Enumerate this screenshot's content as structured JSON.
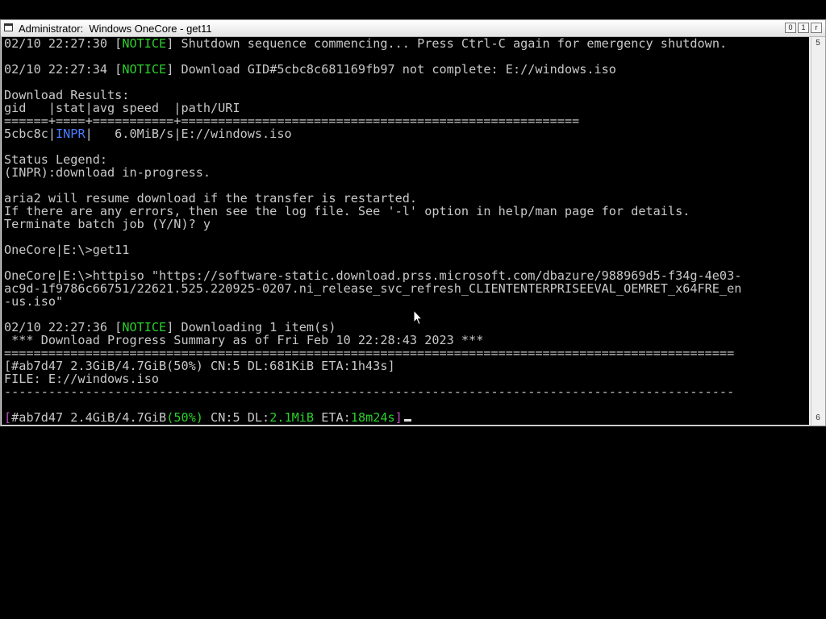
{
  "window": {
    "title": "Administrator:  Windows OneCore - get11",
    "controls": {
      "minimize": "0",
      "maximize": "1",
      "close": "r"
    }
  },
  "scrollbar": {
    "up_glyph": "5",
    "down_glyph": "6"
  },
  "console": {
    "lines": [
      [
        "02/10 22:27:30 [",
        "NOTICE",
        "] Shutdown sequence commencing... Press Ctrl-C again for emergency shutdown."
      ],
      [
        ""
      ],
      [
        "02/10 22:27:34 [",
        "NOTICE",
        "] Download GID#5cbc8c681169fb97 not complete: E://windows.iso"
      ],
      [
        ""
      ],
      [
        "Download Results:"
      ],
      [
        "gid   |stat|avg speed  |path/URI"
      ],
      [
        "======+====+===========+======================================================"
      ],
      [
        "5cbc8c|",
        "INPR",
        "|   6.0MiB/s|E://windows.iso"
      ],
      [
        ""
      ],
      [
        "Status Legend:"
      ],
      [
        "(INPR):download in-progress."
      ],
      [
        ""
      ],
      [
        "aria2 will resume download if the transfer is restarted."
      ],
      [
        "If there are any errors, then see the log file. See '-l' option in help/man page for details."
      ],
      [
        "Terminate batch job (Y/N)? y"
      ],
      [
        ""
      ],
      [
        "OneCore|E:\\>get11"
      ],
      [
        ""
      ],
      [
        "OneCore|E:\\>httpiso \"https://software-static.download.prss.microsoft.com/dbazure/988969d5-f34g-4e03-"
      ],
      [
        "ac9d-1f9786c66751/22621.525.220925-0207.ni_release_svc_refresh_CLIENTENTERPRISEEVAL_OEMRET_x64FRE_en"
      ],
      [
        "-us.iso\""
      ],
      [
        ""
      ],
      [
        "02/10 22:27:36 [",
        "NOTICE",
        "] Downloading 1 item(s)"
      ],
      [
        " *** Download Progress Summary as of Fri Feb 10 22:28:43 2023 ***"
      ],
      [
        "==================================================================================================="
      ],
      [
        "[#ab7d47 2.3GiB/4.7GiB(50%) CN:5 DL:681KiB ETA:1h43s]"
      ],
      [
        "FILE: E://windows.iso"
      ],
      [
        "---------------------------------------------------------------------------------------------------"
      ],
      [
        ""
      ],
      [
        "[",
        "#ab7d47 2.4GiB/4.7GiB",
        "(50%)",
        " CN:5 DL:",
        "2.1MiB",
        " ETA:",
        "18m24s",
        "]"
      ]
    ]
  },
  "colors": {
    "notice": "#2bd02b",
    "status_inpr": "#4a7cff",
    "bracket_progress": "#c050c0",
    "console_text": "#c8c8c8",
    "console_bg": "#000000"
  }
}
